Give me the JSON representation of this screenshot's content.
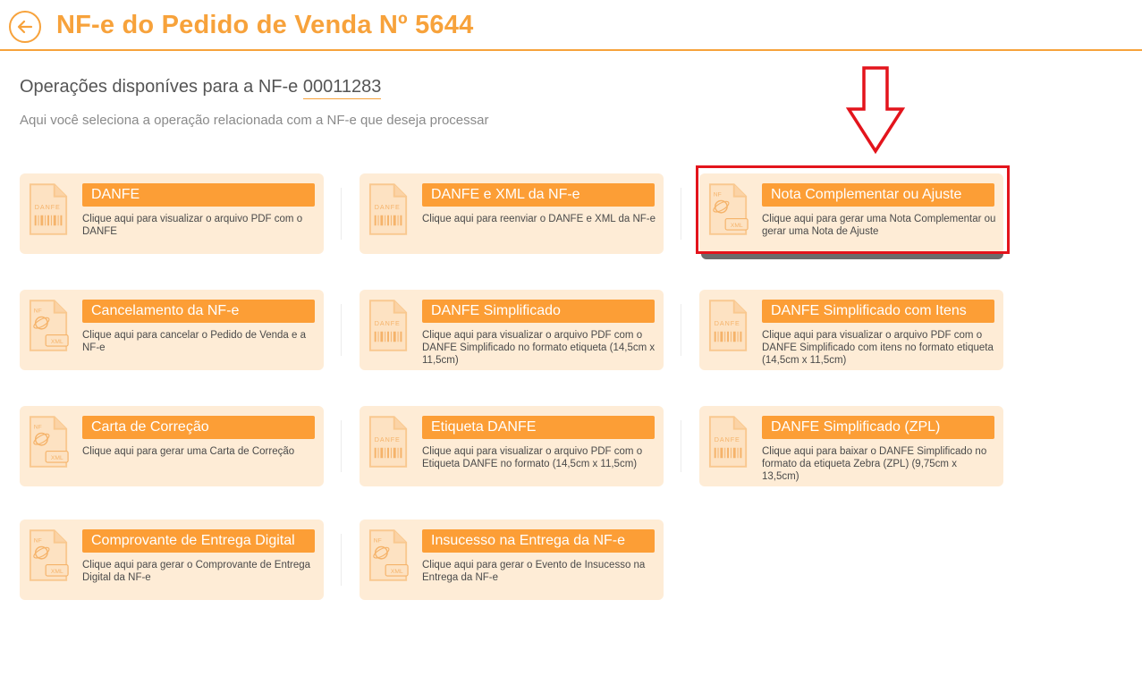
{
  "header": {
    "title": "NF-e do Pedido de Venda Nº 5644"
  },
  "section": {
    "heading_prefix": "Operações disponíves para a NF-e",
    "nfe_number": "00011283",
    "subheading": "Aqui você seleciona a operação relacionada com a NF-e que deseja processar"
  },
  "cards": [
    {
      "title": "DANFE",
      "desc": "Clique aqui para visualizar o arquivo PDF com o DANFE",
      "icon": "danfe-document-icon",
      "icon_label": "DANFE"
    },
    {
      "title": "DANFE e XML da NF-e",
      "desc": "Clique aqui para reenviar o DANFE e XML da NF-e",
      "icon": "danfe-document-icon",
      "icon_label": "DANFE"
    },
    {
      "title": "Nota Complementar ou Ajuste",
      "desc": "Clique aqui para gerar uma Nota Complementar ou gerar uma Nota de Ajuste",
      "icon": "xml-document-icon",
      "icon_label": "XML"
    },
    {
      "title": "Cancelamento da NF-e",
      "desc": "Clique aqui para cancelar o Pedido de Venda e a NF-e",
      "icon": "xml-document-icon",
      "icon_label": "XML"
    },
    {
      "title": "DANFE Simplificado",
      "desc": "Clique aqui para visualizar o arquivo PDF com o DANFE Simplificado no formato etiqueta (14,5cm x 11,5cm)",
      "icon": "danfe-document-icon",
      "icon_label": "DANFE"
    },
    {
      "title": "DANFE Simplificado com Itens",
      "desc": "Clique aqui para visualizar o arquivo PDF com o DANFE Simplificado com itens no formato etiqueta (14,5cm x 11,5cm)",
      "icon": "danfe-document-icon",
      "icon_label": "DANFE"
    },
    {
      "title": "Carta de Correção",
      "desc": "Clique aqui para gerar uma Carta de Correção",
      "icon": "xml-document-icon",
      "icon_label": "XML"
    },
    {
      "title": "Etiqueta DANFE",
      "desc": "Clique aqui para visualizar o arquivo PDF com o Etiqueta DANFE no formato (14,5cm x 11,5cm)",
      "icon": "danfe-document-icon",
      "icon_label": "DANFE"
    },
    {
      "title": "DANFE Simplificado (ZPL)",
      "desc": "Clique aqui para baixar o DANFE Simplificado no formato da etiqueta Zebra (ZPL)  (9,75cm x 13,5cm)",
      "icon": "danfe-document-icon",
      "icon_label": "DANFE"
    },
    {
      "title": "Comprovante de Entrega Digital",
      "desc": "Clique aqui para gerar o Comprovante de Entrega Digital da NF-e",
      "icon": "xml-document-icon",
      "icon_label": "XML"
    },
    {
      "title": "Insucesso na Entrega da NF-e",
      "desc": "Clique aqui para gerar o Evento de Insucesso na Entrega da NF-e",
      "icon": "xml-document-icon",
      "icon_label": "XML"
    }
  ],
  "icons": {
    "back": "arrow-left-circle-icon",
    "annotation_arrow": "down-arrow-outline-icon"
  },
  "colors": {
    "accent": "#f7a23b",
    "card_bg": "#feecd6",
    "card_title_bg": "#fc9e36",
    "highlight": "#e3141c"
  }
}
